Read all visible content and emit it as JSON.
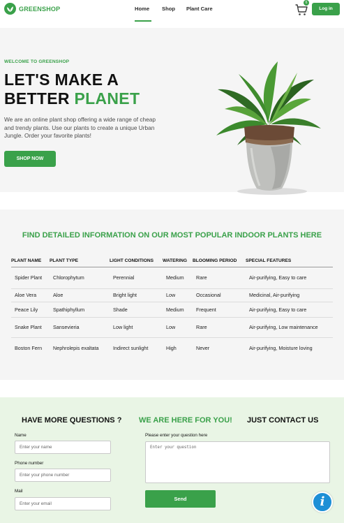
{
  "header": {
    "logo_text": "GREENSHOP",
    "nav": [
      "Home",
      "Shop",
      "Plant Care"
    ],
    "cart_count": "6",
    "login_label": "Log in"
  },
  "hero": {
    "eyebrow": "WELCOME TO GREENSHOP",
    "title_line1": "LET'S MAKE A",
    "title_line2_plain": "BETTER ",
    "title_line2_accent": "PLANET",
    "description": "We are an online plant shop offering a wide range of cheap and trendy plants. Use our plants to create a unique Urban Jungle. Order your favorite plants!",
    "button_label": "SHOP NOW"
  },
  "table": {
    "title": "FIND DETAILED INFORMATION ON OUR MOST POPULAR INDOOR PLANTS HERE",
    "columns": [
      "PLANT NAME",
      "PLANT TYPE",
      "LIGHT CONDITIONS",
      "WATERING",
      "BLOOMING PERIOD",
      "SPECIAL FEATURES"
    ],
    "rows": [
      [
        "Spider Plant",
        "Chlorophytum",
        "Perennial",
        "Medium",
        "Rare",
        "Air-purifying, Easy to care"
      ],
      [
        "Aloe Vera",
        "Aloe",
        "Bright light",
        "Low",
        "Occasional",
        "Medicinal, Air-purifying"
      ],
      [
        "Peace Lily",
        "Spathiphyllum",
        "Shade",
        "Medium",
        "Frequent",
        "Air-purifying, Easy to care"
      ],
      [
        "Snake Plant",
        "Sansevieria",
        "Low light",
        "Low",
        "Rare",
        "Air-purifying, Low maintenance"
      ],
      [
        "Boston Fern",
        "Nephrolepis exaltata",
        "Indirect sunlight",
        "High",
        "Never",
        "Air-purifying, Moisture loving"
      ]
    ]
  },
  "contact": {
    "heading_1": "HAVE MORE QUESTIONS ?",
    "heading_2": "WE ARE HERE FOR YOU!",
    "heading_3": "JUST CONTACT US",
    "name_label": "Name",
    "name_placeholder": "Enter your name",
    "phone_label": "Phone number",
    "phone_placeholder": "Enter your phone number",
    "mail_label": "Mail",
    "mail_placeholder": "Enter your email",
    "question_label": "Please enter your question here",
    "question_placeholder": "Enter your question",
    "send_label": "Send",
    "info_label": "i"
  },
  "colors": {
    "brand_green": "#3aa14a",
    "info_blue": "#1d8fd6"
  }
}
